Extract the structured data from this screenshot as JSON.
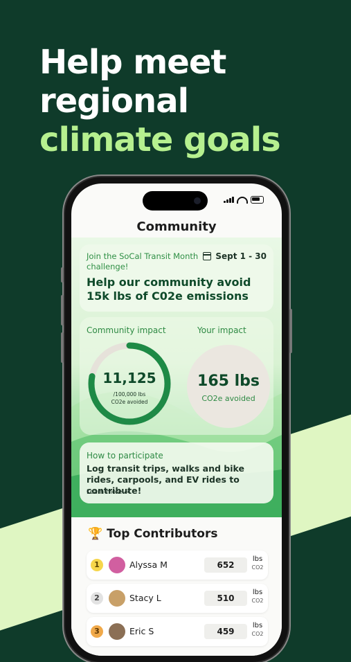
{
  "headline": {
    "line1": "Help meet",
    "line2": "regional",
    "line3": "climate goals"
  },
  "screen": {
    "title": "Community",
    "challenge": {
      "join_text": "Join the SoCal Transit Month challenge!",
      "date": "Sept 1 - 30",
      "cta": "Help our community avoid 15k lbs of C02e emissions"
    },
    "impact": {
      "community_label": "Community impact",
      "community_value": "11,125",
      "community_sub1": "/100,000 lbs",
      "community_sub2": "CO2e avoided",
      "progress_fraction": 0.78,
      "your_label": "Your impact",
      "your_value": "165 lbs",
      "your_sub": "CO2e avoided"
    },
    "participate": {
      "title": "How to participate",
      "text": "Log transit trips, walks and bike rides, carpools, and EV rides to contribute!",
      "learn_more": "Learn more →"
    },
    "contributors": {
      "title": "Top Contributors",
      "rows": [
        {
          "rank": "1",
          "name": "Alyssa M",
          "value": "652",
          "unit": "lbs",
          "unit_sub": "CO2"
        },
        {
          "rank": "2",
          "name": "Stacy L",
          "value": "510",
          "unit": "lbs",
          "unit_sub": "CO2"
        },
        {
          "rank": "3",
          "name": "Eric S",
          "value": "459",
          "unit": "lbs",
          "unit_sub": "CO2"
        }
      ]
    }
  },
  "colors": {
    "background": "#0f3b2a",
    "accent_green": "#1e8a46",
    "headline_green": "#b6f08f"
  }
}
